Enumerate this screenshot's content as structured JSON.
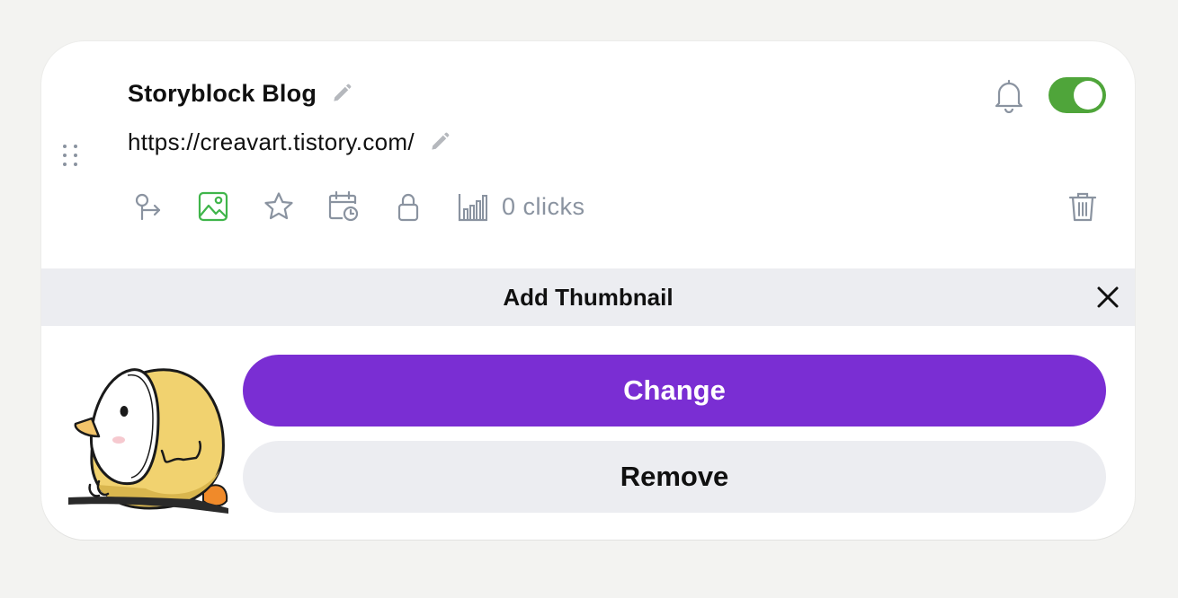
{
  "link": {
    "title": "Storyblock Blog",
    "url": "https://creavart.tistory.com/",
    "enabled": true,
    "clicks_label": "0 clicks"
  },
  "icons": {
    "drag": "drag-handle-icon",
    "edit_title": "pencil-icon",
    "edit_url": "pencil-icon",
    "notifications": "bell-icon",
    "redirect": "redirect-arrow-icon",
    "thumbnail": "image-icon",
    "priority": "star-icon",
    "schedule": "calendar-clock-icon",
    "lock": "lock-icon",
    "analytics": "bar-chart-icon",
    "delete": "trash-icon",
    "close": "close-icon"
  },
  "thumbnail_panel": {
    "title": "Add Thumbnail",
    "change_label": "Change",
    "remove_label": "Remove"
  },
  "colors": {
    "toggle_on": "#4fa53a",
    "active_icon": "#3fb54a",
    "primary_button": "#7a2ed3",
    "secondary_button": "#ecedf1",
    "muted_icon": "#8a93a0"
  }
}
